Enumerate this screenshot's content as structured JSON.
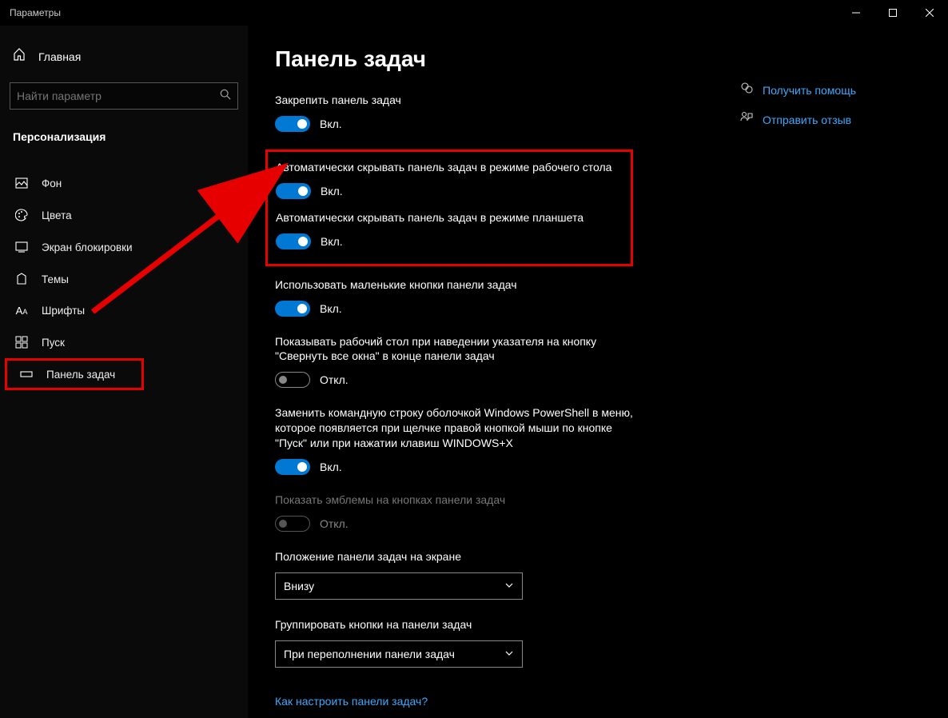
{
  "window": {
    "title": "Параметры"
  },
  "sidebar": {
    "home": "Главная",
    "search_placeholder": "Найти параметр",
    "category": "Персонализация",
    "items": [
      {
        "label": "Фон"
      },
      {
        "label": "Цвета"
      },
      {
        "label": "Экран блокировки"
      },
      {
        "label": "Темы"
      },
      {
        "label": "Шрифты"
      },
      {
        "label": "Пуск"
      },
      {
        "label": "Панель задач"
      }
    ]
  },
  "page": {
    "title": "Панель задач",
    "state_on": "Вкл.",
    "state_off": "Откл.",
    "settings": {
      "lock": "Закрепить панель задач",
      "autohide_desktop": "Автоматически скрывать панель задач в режиме рабочего стола",
      "autohide_tablet": "Автоматически скрывать панель задач в режиме планшета",
      "small_buttons": "Использовать маленькие кнопки панели задач",
      "peek": "Показывать рабочий стол при наведении указателя на кнопку \"Свернуть все окна\" в конце панели задач",
      "powershell": "Заменить командную строку оболочкой Windows PowerShell в меню, которое появляется при щелчке правой кнопкой мыши по кнопке \"Пуск\" или при нажатии клавиш WINDOWS+X",
      "badges": "Показать эмблемы на кнопках панели задач",
      "position_label": "Положение панели задач на экране",
      "position_value": "Внизу",
      "combine_label": "Группировать кнопки на панели задач",
      "combine_value": "При переполнении панели задач",
      "customize_link": "Как настроить панели задач?"
    }
  },
  "sidelinks": {
    "help": "Получить помощь",
    "feedback": "Отправить отзыв"
  }
}
